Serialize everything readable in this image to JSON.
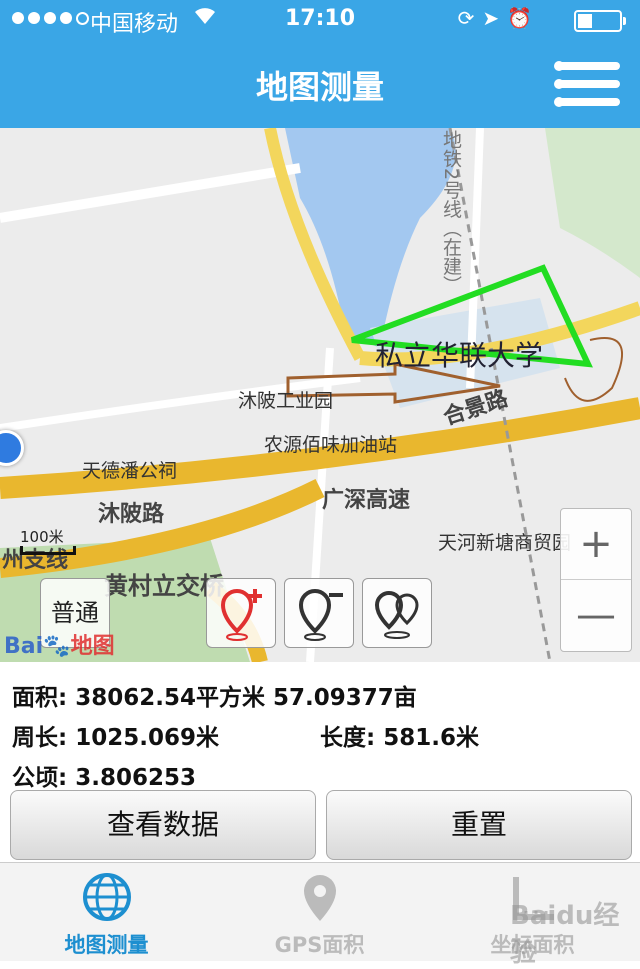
{
  "status_bar": {
    "carrier": "中国移动",
    "time": "17:10",
    "wifi_icon": "wifi-icon",
    "icons": [
      "orientation-lock-icon",
      "location-arrow-icon",
      "alarm-icon",
      "battery-icon"
    ]
  },
  "header": {
    "title": "地图测量",
    "menu_icon": "menu-icon"
  },
  "map": {
    "labels": {
      "metro": "地铁2号线（在建）",
      "university": "私立华联大学",
      "industrial_park": "沐陂工业园",
      "gas_station": "农源佰味加油站",
      "company": "天德潘公祠",
      "mupo_road": "沐陂路",
      "guangshen": "广深高速",
      "hejing_road": "合景路",
      "huangcun": "黄村立交桥",
      "tianhe": "天河新塘商贸园",
      "huangcun_branch": "州支线"
    },
    "scale_text": "100米",
    "mode_label": "普通",
    "zoom_in": "+",
    "zoom_out": "—",
    "logo_text": "Bai",
    "logo_text2": "地图"
  },
  "measurements": {
    "area": "面积: 38062.54平方米 57.09377亩",
    "perimeter": "周长: 1025.069米",
    "length": "长度: 581.6米",
    "hectare": "公顷: 3.806253"
  },
  "buttons": {
    "view_data": "查看数据",
    "reset": "重置"
  },
  "tabs": [
    {
      "label": "地图测量",
      "icon": "globe-icon"
    },
    {
      "label": "GPS面积",
      "icon": "pin-icon"
    },
    {
      "label": "坐标面积",
      "icon": "ruler-icon"
    }
  ],
  "colors": {
    "header_bg": "#3aa6e6",
    "polygon": "#22dd22",
    "active_tab": "#1d8fd0"
  },
  "watermark": "Baidu经验"
}
